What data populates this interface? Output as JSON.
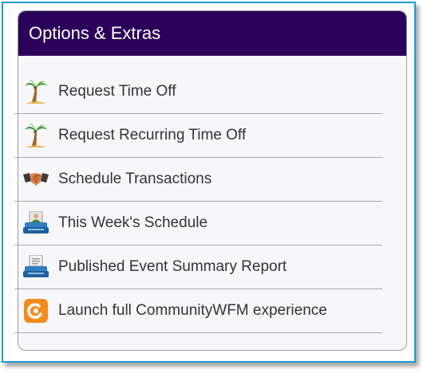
{
  "panel": {
    "title": "Options & Extras",
    "header_color": "#2b005a",
    "items": [
      {
        "label": "Request Time Off",
        "icon": "palm-tree-icon"
      },
      {
        "label": "Request Recurring Time Off",
        "icon": "palm-tree-icon"
      },
      {
        "label": "Schedule Transactions",
        "icon": "handshake-icon"
      },
      {
        "label": "This Week's Schedule",
        "icon": "person-at-desk-icon"
      },
      {
        "label": "Published Event Summary Report",
        "icon": "printer-icon"
      },
      {
        "label": "Launch full CommunityWFM experience",
        "icon": "communitywfm-logo-icon"
      }
    ]
  }
}
